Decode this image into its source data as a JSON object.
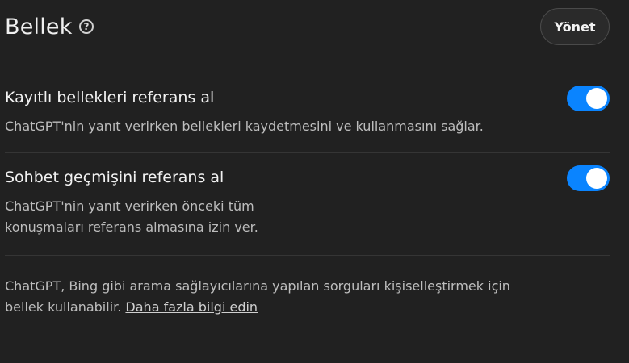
{
  "header": {
    "title": "Bellek",
    "help_icon": "question-circle-icon",
    "manage_label": "Yönet"
  },
  "settings": [
    {
      "title": "Kayıtlı bellekleri referans al",
      "description_lines": [
        "ChatGPT'nin yanıt verirken bellekleri kaydetmesini ve kullanmasını sağlar."
      ],
      "enabled": true
    },
    {
      "title": "Sohbet geçmişini referans al",
      "description_lines": [
        "ChatGPT'nin yanıt verirken önceki tüm",
        "konuşmaları referans almasına izin ver."
      ],
      "enabled": true
    }
  ],
  "footer": {
    "line1": "ChatGPT, Bing gibi arama sağlayıcılarına yapılan sorguları kişiselleştirmek için",
    "line2_prefix": "bellek kullanabilir. ",
    "link_label": "Daha fazla bilgi edin"
  },
  "colors": {
    "background": "#212121",
    "toggle_on": "#0a84ff"
  }
}
